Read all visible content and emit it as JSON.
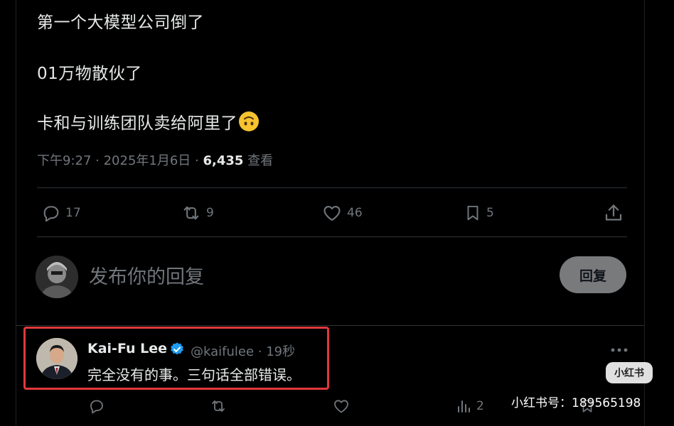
{
  "tweet": {
    "lines": [
      "第一个大模型公司倒了",
      "01万物散伙了",
      "卡和与训练团队卖给阿里了"
    ],
    "emoji": "upside-down-face-emoji",
    "time": "下午9:27 · 2025年1月6日 · ",
    "views_count": "6,435",
    "views_label": " 查看"
  },
  "actions": {
    "replies": "17",
    "retweets": "9",
    "likes": "46",
    "bookmarks": "5"
  },
  "compose": {
    "placeholder": "发布你的回复",
    "button_label": "回复"
  },
  "reply": {
    "author_name": "Kai-Fu Lee",
    "handle": "@kaifulee · 19秒",
    "text": "完全没有的事。三句话全部错误。",
    "views": "2"
  },
  "watermark": {
    "logo_text": "小红书",
    "id_text": "小红书号：189565198"
  },
  "colors": {
    "background": "#000000",
    "text_primary": "#e7e9ea",
    "text_secondary": "#71767b",
    "verified_blue": "#1d9bf0",
    "highlight_red": "#e0393b",
    "reply_button": "#787a7c"
  }
}
